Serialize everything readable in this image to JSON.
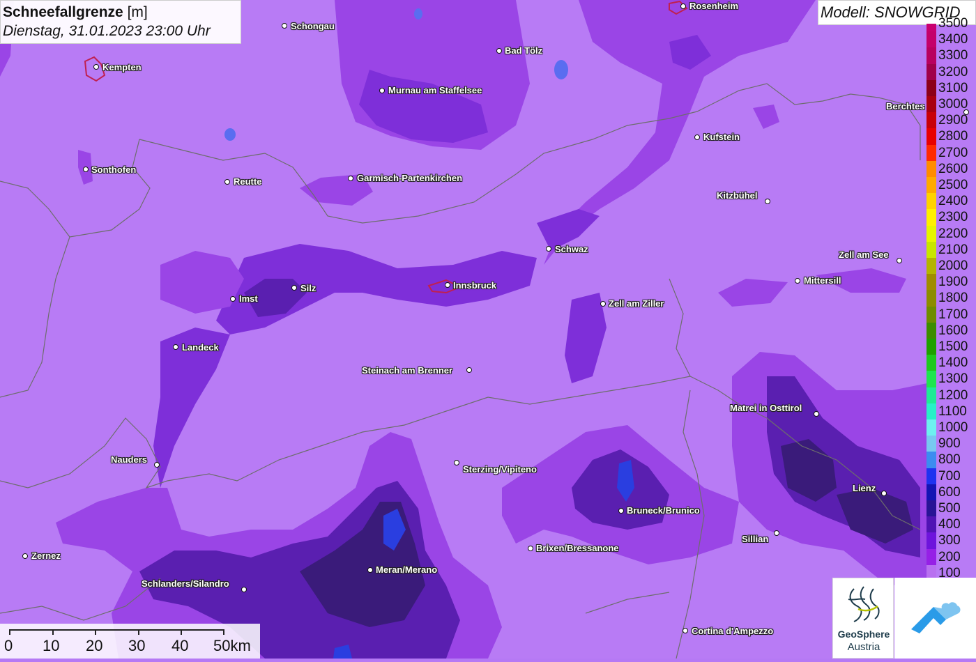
{
  "header": {
    "title_main": "Schneefallgrenze",
    "title_unit": "[m]",
    "datetime": "Dienstag, 31.01.2023 23:00 Uhr"
  },
  "model": {
    "label": "Modell: SNOWGRID"
  },
  "cities": {
    "rosenheim": "Rosenheim",
    "schongau": "Schongau",
    "kempten": "Kempten",
    "bad_toelz": "Bad Tölz",
    "murnau": "Murnau am Staffelsee",
    "berchtesgaden": "Berchtes",
    "kufstein": "Kufstein",
    "sonthofen": "Sonthofen",
    "reutte": "Reutte",
    "garmisch": "Garmisch-Partenkirchen",
    "kitzbuehel": "Kitzbühel",
    "schwaz": "Schwaz",
    "zell_am_see": "Zell am See",
    "mittersill": "Mittersill",
    "imst": "Imst",
    "silz": "Silz",
    "innsbruck": "Innsbruck",
    "zell_am_ziller": "Zell am Ziller",
    "landeck": "Landeck",
    "steinach": "Steinach am Brenner",
    "matrei": "Matrei in Osttirol",
    "nauders": "Nauders",
    "sterzing": "Sterzing/Vipiteno",
    "lienz": "Lienz",
    "bruneck": "Bruneck/Brunico",
    "sillian": "Sillian",
    "brixen": "Brixen/Bressanone",
    "zernez": "Zernez",
    "meran": "Meran/Merano",
    "schlanders": "Schlanders/Silandro",
    "cortina": "Cortina d'Ampezzo"
  },
  "legend": {
    "items": [
      {
        "label": "3500",
        "color": "#c8006e"
      },
      {
        "label": "3400",
        "color": "#c4006a"
      },
      {
        "label": "3300",
        "color": "#b8005f"
      },
      {
        "label": "3200",
        "color": "#a0004a"
      },
      {
        "label": "3100",
        "color": "#8c0018"
      },
      {
        "label": "3000",
        "color": "#a80010"
      },
      {
        "label": "2900",
        "color": "#c80008"
      },
      {
        "label": "2800",
        "color": "#e80000"
      },
      {
        "label": "2700",
        "color": "#ff2a00"
      },
      {
        "label": "2600",
        "color": "#ff8c00"
      },
      {
        "label": "2500",
        "color": "#ffaa00"
      },
      {
        "label": "2400",
        "color": "#ffd200"
      },
      {
        "label": "2300",
        "color": "#fff000"
      },
      {
        "label": "2200",
        "color": "#e6f500"
      },
      {
        "label": "2100",
        "color": "#c8e600"
      },
      {
        "label": "2000",
        "color": "#b4b400"
      },
      {
        "label": "1900",
        "color": "#a08c00"
      },
      {
        "label": "1800",
        "color": "#8c8c00"
      },
      {
        "label": "1700",
        "color": "#6e8c00"
      },
      {
        "label": "1600",
        "color": "#3c8c00"
      },
      {
        "label": "1500",
        "color": "#1ea000"
      },
      {
        "label": "1400",
        "color": "#1ec81e"
      },
      {
        "label": "1300",
        "color": "#1ee650"
      },
      {
        "label": "1200",
        "color": "#1eeb96"
      },
      {
        "label": "1100",
        "color": "#28f0c8"
      },
      {
        "label": "1000",
        "color": "#6ef0f0"
      },
      {
        "label": "900",
        "color": "#78c8f0"
      },
      {
        "label": "800",
        "color": "#3c8cf0"
      },
      {
        "label": "700",
        "color": "#1e32f0"
      },
      {
        "label": "600",
        "color": "#1414b4"
      },
      {
        "label": "500",
        "color": "#281496"
      },
      {
        "label": "400",
        "color": "#5014b4"
      },
      {
        "label": "300",
        "color": "#6e14dc"
      },
      {
        "label": "200",
        "color": "#9620e6"
      },
      {
        "label": "100",
        "color": "#b870f0"
      }
    ]
  },
  "scale_bar": {
    "labels": [
      "0",
      "10",
      "20",
      "30",
      "40",
      "50km"
    ]
  },
  "logos": {
    "geosphere_line1": "GeoSphere",
    "geosphere_line2": "Austria"
  }
}
